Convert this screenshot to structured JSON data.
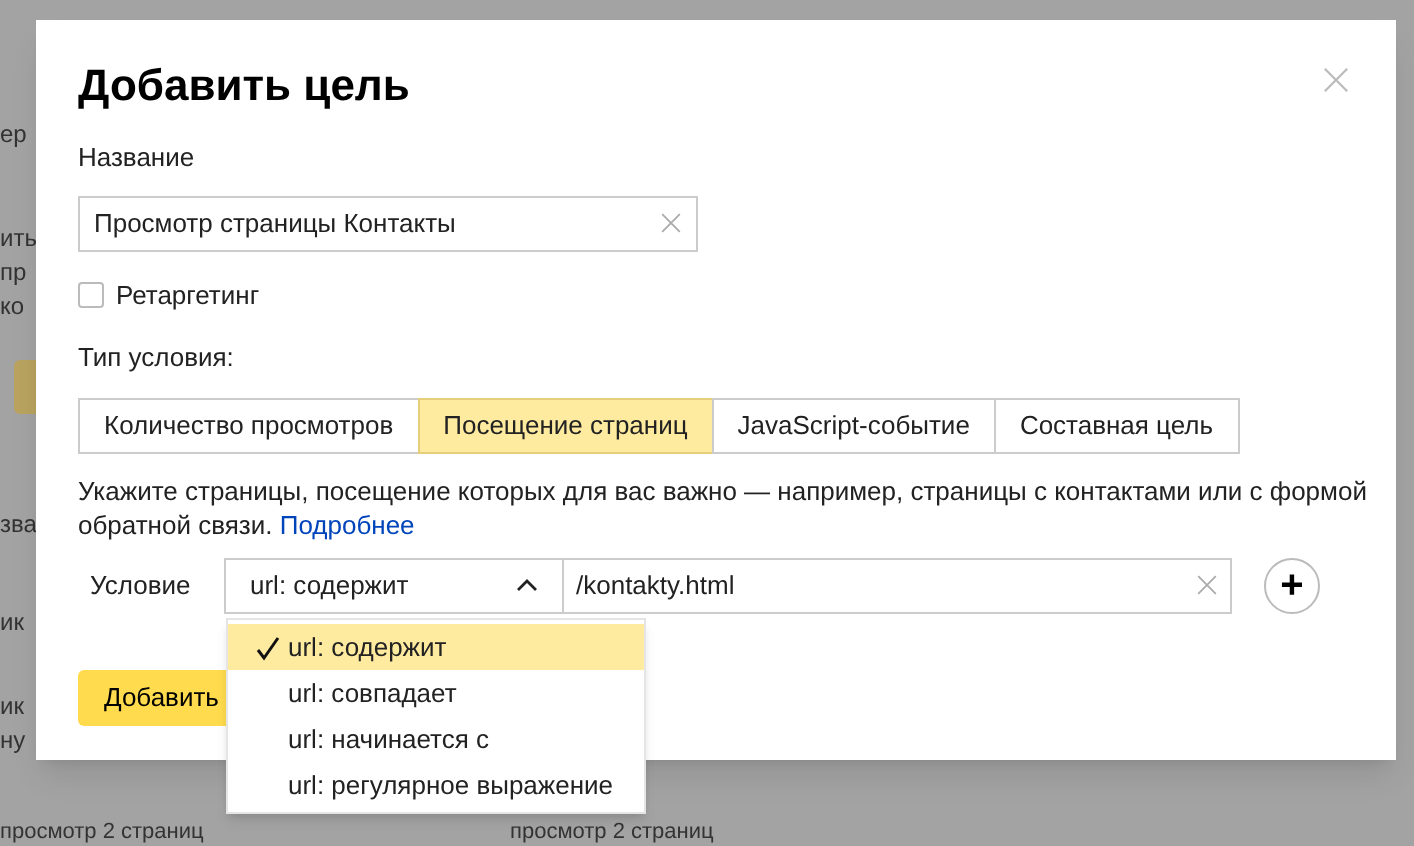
{
  "background": {
    "fragments": [
      "ер",
      "ить",
      "пр",
      "ко",
      "зва",
      "ик",
      "ик",
      "ну"
    ],
    "rows": [
      "просмотр 2 страниц",
      "просмотр 2 страниц"
    ]
  },
  "dialog": {
    "title": "Добавить цель",
    "name_label": "Название",
    "name_field": {
      "value": "Просмотр страницы Контакты"
    },
    "retargeting": {
      "label": "Ретаргетинг",
      "checked": false
    },
    "condition_type_label": "Тип условия:",
    "tabs": [
      {
        "label": "Количество просмотров",
        "selected": false
      },
      {
        "label": "Посещение страниц",
        "selected": true
      },
      {
        "label": "JavaScript-событие",
        "selected": false
      },
      {
        "label": "Составная цель",
        "selected": false
      }
    ],
    "hint": "Укажите страницы, посещение которых для вас важно — например, страницы с контактами или с формой обратной связи.",
    "hint_link": "Подробнее",
    "condition": {
      "label": "Условие",
      "select": {
        "value": "url: содержит",
        "expanded": true
      },
      "url_field": {
        "value": "/kontakty.html"
      },
      "add_button": "+"
    },
    "submit_button": "Добавить",
    "dropdown": [
      {
        "label": "url: содержит",
        "selected": true
      },
      {
        "label": "url: совпадает",
        "selected": false
      },
      {
        "label": "url: начинается с",
        "selected": false
      },
      {
        "label": "url: регулярное выражение",
        "selected": false
      }
    ]
  }
}
